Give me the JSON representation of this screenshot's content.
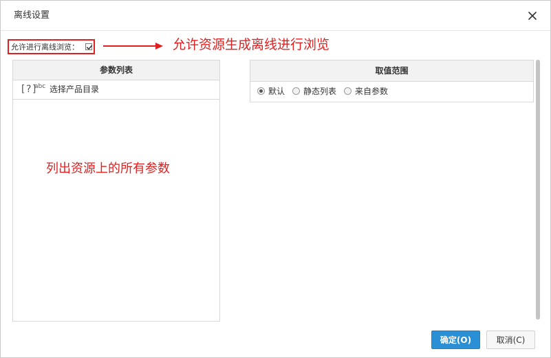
{
  "dialog": {
    "title": "离线设置",
    "close_icon": "close-icon"
  },
  "offline": {
    "label": "允许进行离线浏览：",
    "checked": true
  },
  "annotations": {
    "top": "允许资源生成离线进行浏览",
    "middle": "列出资源上的所有参数"
  },
  "param_list": {
    "header": "参数列表",
    "items": [
      {
        "type_icon": "[?]",
        "sub_icon": "abc",
        "name": "选择产品目录"
      }
    ]
  },
  "value_range": {
    "header": "取值范围",
    "options": [
      {
        "label": "默认",
        "selected": true
      },
      {
        "label": "静态列表",
        "selected": false
      },
      {
        "label": "来自参数",
        "selected": false
      }
    ]
  },
  "buttons": {
    "ok": "确定(O)",
    "cancel": "取消(C)"
  },
  "colors": {
    "annotation": "#e02020",
    "primary": "#2b8fd5"
  }
}
